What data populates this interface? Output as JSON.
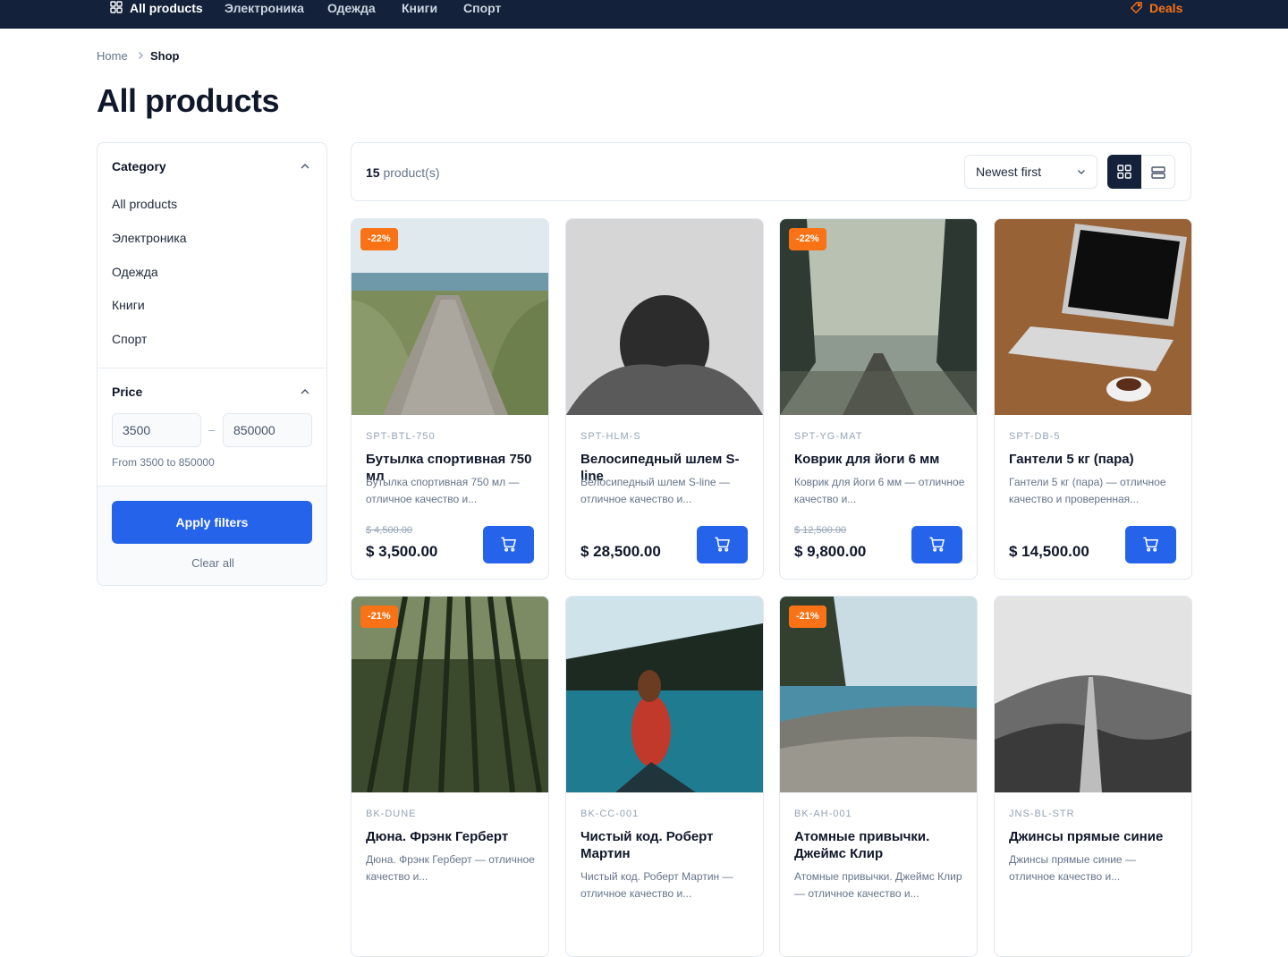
{
  "nav": {
    "items": [
      "All products",
      "Электроника",
      "Одежда",
      "Книги",
      "Спорт"
    ],
    "deals": "Deals"
  },
  "breadcrumb": {
    "home": "Home",
    "current": "Shop"
  },
  "page_title": "All products",
  "filters": {
    "category_heading": "Category",
    "categories": [
      "All products",
      "Электроника",
      "Одежда",
      "Книги",
      "Спорт"
    ],
    "price_heading": "Price",
    "price_min": "3500",
    "price_max": "850000",
    "price_dash": "–",
    "price_note": "From 3500 to 850000",
    "apply_label": "Apply filters",
    "clear_label": "Clear all"
  },
  "toolbar": {
    "count": "15",
    "count_suffix": "product(s)",
    "sort_value": "Newest first"
  },
  "colors": {
    "nav_bg": "#13213a",
    "accent": "#2563eb",
    "badge": "#f97316"
  },
  "products": [
    {
      "badge": "-22%",
      "sku": "SPT-BTL-750",
      "name": "Бутылка спортивная 750 мл",
      "desc": "Бутылка спортивная 750 мл — отличное качество и...",
      "old_price": "$ 4,500.00",
      "price": "$ 3,500.00"
    },
    {
      "badge": "",
      "sku": "SPT-HLM-S",
      "name": "Велосипедный шлем S-line",
      "desc": "Велосипедный шлем S-line — отличное качество и...",
      "old_price": "",
      "price": "$ 28,500.00"
    },
    {
      "badge": "-22%",
      "sku": "SPT-YG-MAT",
      "name": "Коврик для йоги 6 мм",
      "desc": "Коврик для йоги 6 мм — отличное качество и...",
      "old_price": "$ 12,500.00",
      "price": "$ 9,800.00"
    },
    {
      "badge": "",
      "sku": "SPT-DB-5",
      "name": "Гантели 5 кг (пара)",
      "desc": "Гантели 5 кг (пара) — отличное качество и проверенная...",
      "old_price": "",
      "price": "$ 14,500.00"
    },
    {
      "badge": "-21%",
      "sku": "BK-DUNE",
      "name": "Дюна. Фрэнк Герберт",
      "desc": "Дюна. Фрэнк Герберт — отличное качество и...",
      "old_price": "",
      "price": ""
    },
    {
      "badge": "",
      "sku": "BK-CC-001",
      "name": "Чистый код. Роберт Мартин",
      "desc": "Чистый код. Роберт Мартин — отличное качество и...",
      "old_price": "",
      "price": ""
    },
    {
      "badge": "-21%",
      "sku": "BK-AH-001",
      "name": "Атомные привычки. Джеймс Клир",
      "desc": "Атомные привычки. Джеймс Клир — отличное качество и...",
      "old_price": "",
      "price": ""
    },
    {
      "badge": "",
      "sku": "JNS-BL-STR",
      "name": "Джинсы прямые синие",
      "desc": "Джинсы прямые синие — отличное качество и...",
      "old_price": "",
      "price": ""
    }
  ]
}
